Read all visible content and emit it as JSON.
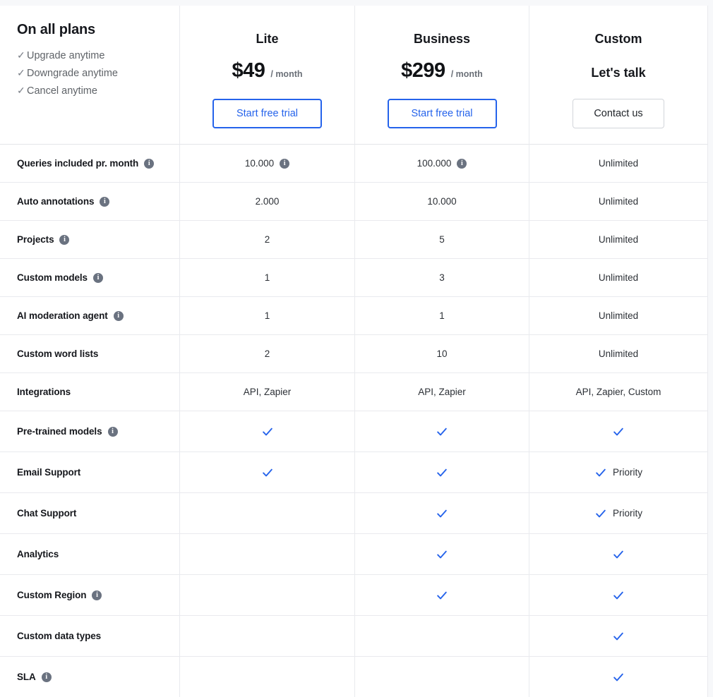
{
  "colors": {
    "accent": "#2563EB",
    "check": "#2563EB",
    "info_icon_bg": "#6A7280",
    "page_bg": "#F7F8FA",
    "card_bg": "#FFFFFF",
    "border": "#E9EAEE",
    "muted_text": "#5F6368"
  },
  "intro": {
    "title": "On all plans",
    "check_glyph": "✓",
    "items": [
      "Upgrade anytime",
      "Downgrade anytime",
      "Cancel anytime"
    ]
  },
  "plans": [
    {
      "name": "Lite",
      "price": "$49",
      "period": "/ month",
      "tagline": null,
      "cta_label": "Start free trial",
      "cta_style": "primary"
    },
    {
      "name": "Business",
      "price": "$299",
      "period": "/ month",
      "tagline": null,
      "cta_label": "Start free trial",
      "cta_style": "primary"
    },
    {
      "name": "Custom",
      "price": null,
      "period": null,
      "tagline": "Let's talk",
      "cta_label": "Contact us",
      "cta_style": "secondary"
    }
  ],
  "info_glyph": "i",
  "features": [
    {
      "label": "Queries included pr. month",
      "label_info": true,
      "cells": [
        {
          "type": "text",
          "text": "10.000",
          "info": true
        },
        {
          "type": "text",
          "text": "100.000",
          "info": true
        },
        {
          "type": "text",
          "text": "Unlimited",
          "info": false
        }
      ]
    },
    {
      "label": "Auto annotations",
      "label_info": true,
      "cells": [
        {
          "type": "text",
          "text": "2.000",
          "info": false
        },
        {
          "type": "text",
          "text": "10.000",
          "info": false
        },
        {
          "type": "text",
          "text": "Unlimited",
          "info": false
        }
      ]
    },
    {
      "label": "Projects",
      "label_info": true,
      "cells": [
        {
          "type": "text",
          "text": "2",
          "info": false
        },
        {
          "type": "text",
          "text": "5",
          "info": false
        },
        {
          "type": "text",
          "text": "Unlimited",
          "info": false
        }
      ]
    },
    {
      "label": "Custom models",
      "label_info": true,
      "cells": [
        {
          "type": "text",
          "text": "1",
          "info": false
        },
        {
          "type": "text",
          "text": "3",
          "info": false
        },
        {
          "type": "text",
          "text": "Unlimited",
          "info": false
        }
      ]
    },
    {
      "label": "AI moderation agent",
      "label_info": true,
      "cells": [
        {
          "type": "text",
          "text": "1",
          "info": false
        },
        {
          "type": "text",
          "text": "1",
          "info": false
        },
        {
          "type": "text",
          "text": "Unlimited",
          "info": false
        }
      ]
    },
    {
      "label": "Custom word lists",
      "label_info": false,
      "cells": [
        {
          "type": "text",
          "text": "2",
          "info": false
        },
        {
          "type": "text",
          "text": "10",
          "info": false
        },
        {
          "type": "text",
          "text": "Unlimited",
          "info": false
        }
      ]
    },
    {
      "label": "Integrations",
      "label_info": false,
      "cells": [
        {
          "type": "text",
          "text": "API, Zapier",
          "info": false
        },
        {
          "type": "text",
          "text": "API, Zapier",
          "info": false
        },
        {
          "type": "text",
          "text": "API, Zapier, Custom",
          "info": false
        }
      ]
    },
    {
      "label": "Pre-trained models",
      "label_info": true,
      "tall": true,
      "cells": [
        {
          "type": "check",
          "text": null
        },
        {
          "type": "check",
          "text": null
        },
        {
          "type": "check",
          "text": null
        }
      ]
    },
    {
      "label": "Email Support",
      "label_info": false,
      "tall": true,
      "cells": [
        {
          "type": "check",
          "text": null
        },
        {
          "type": "check",
          "text": null
        },
        {
          "type": "check",
          "text": "Priority"
        }
      ]
    },
    {
      "label": "Chat Support",
      "label_info": false,
      "tall": true,
      "cells": [
        {
          "type": "empty",
          "text": null
        },
        {
          "type": "check",
          "text": null
        },
        {
          "type": "check",
          "text": "Priority"
        }
      ]
    },
    {
      "label": "Analytics",
      "label_info": false,
      "tall": true,
      "cells": [
        {
          "type": "empty",
          "text": null
        },
        {
          "type": "check",
          "text": null
        },
        {
          "type": "check",
          "text": null
        }
      ]
    },
    {
      "label": "Custom Region",
      "label_info": true,
      "tall": true,
      "cells": [
        {
          "type": "empty",
          "text": null
        },
        {
          "type": "check",
          "text": null
        },
        {
          "type": "check",
          "text": null
        }
      ]
    },
    {
      "label": "Custom data types",
      "label_info": false,
      "tall": true,
      "cells": [
        {
          "type": "empty",
          "text": null
        },
        {
          "type": "empty",
          "text": null
        },
        {
          "type": "check",
          "text": null
        }
      ]
    },
    {
      "label": "SLA",
      "label_info": true,
      "tall": true,
      "cells": [
        {
          "type": "empty",
          "text": null
        },
        {
          "type": "empty",
          "text": null
        },
        {
          "type": "check",
          "text": null
        }
      ]
    }
  ]
}
